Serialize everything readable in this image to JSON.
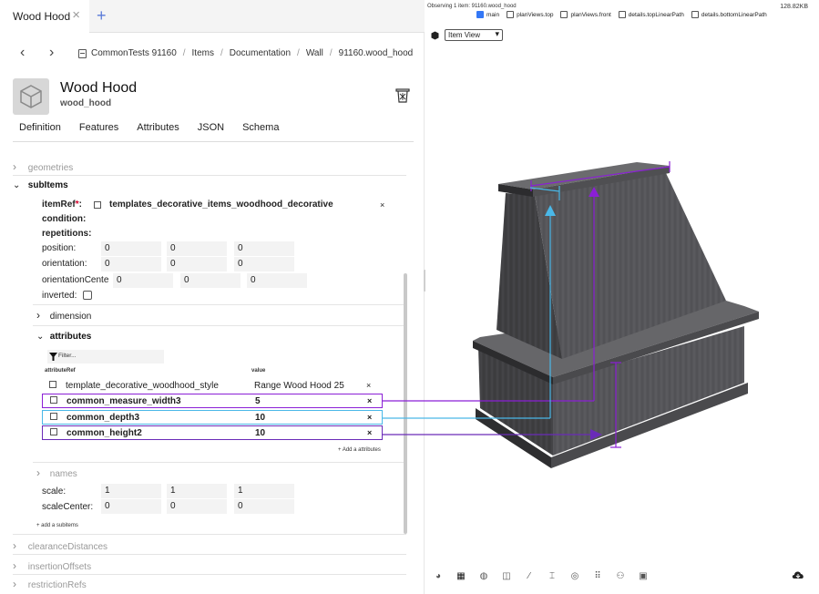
{
  "tab": {
    "label": "Wood Hood"
  },
  "breadcrumbs": [
    "CommonTests 91160",
    "Items",
    "Documentation",
    "Wall",
    "91160.wood_hood"
  ],
  "item": {
    "title": "Wood Hood",
    "id": "wood_hood"
  },
  "editor_tabs": [
    "Definition",
    "Features",
    "Attributes",
    "JSON",
    "Schema"
  ],
  "sections": {
    "geometries": "geometries",
    "subitems": "subItems",
    "dimension": "dimension",
    "attributes": "attributes",
    "names": "names",
    "clearance": "clearanceDistances",
    "insertion": "insertionOffsets",
    "restriction": "restrictionRefs"
  },
  "subitem": {
    "itemref_label": "itemRef",
    "itemref_required": "*",
    "itemref_colon": ":",
    "itemref_value": "templates_decorative_items_woodhood_decorative",
    "condition": "condition:",
    "repetitions": "repetitions:",
    "position_label": "position:",
    "position": [
      "0",
      "0",
      "0"
    ],
    "orientation_label": "orientation:",
    "orientation": [
      "0",
      "0",
      "0"
    ],
    "orientation_center_label": "orientationCente",
    "orientation_center": [
      "0",
      "0",
      "0"
    ],
    "inverted_label": "inverted:",
    "scale_label": "scale:",
    "scale": [
      "1",
      "1",
      "1"
    ],
    "scale_center_label": "scaleCenter:",
    "scale_center": [
      "0",
      "0",
      "0"
    ],
    "add_subitems": "+ add a subitems"
  },
  "attributes": {
    "filter_placeholder": "Filter...",
    "col_ref": "attributeRef",
    "col_value": "value",
    "rows": [
      {
        "name": "template_decorative_woodhood_style",
        "value": "Range Wood Hood 25"
      },
      {
        "name": "common_measure_width3",
        "value": "5"
      },
      {
        "name": "common_depth3",
        "value": "10"
      },
      {
        "name": "common_height2",
        "value": "10"
      }
    ],
    "add_label": "+ Add a attributes"
  },
  "viewer": {
    "observing": "Observing 1 item: 91160.wood_hood",
    "size": "128.82KB",
    "paths": [
      {
        "label": "main",
        "checked": true
      },
      {
        "label": "planViews.top",
        "checked": false
      },
      {
        "label": "planViews.front",
        "checked": false
      },
      {
        "label": "details.topLinearPath",
        "checked": false
      },
      {
        "label": "details.bottomLinearPath",
        "checked": false
      }
    ],
    "view_select": "Item View"
  },
  "colors": {
    "highlight_purple": "#8b1fd6",
    "highlight_blue": "#4ab8e8",
    "accent_blue": "#5a7bd8",
    "hood_dark": "#3a3a3c"
  },
  "close_symbol": "×"
}
